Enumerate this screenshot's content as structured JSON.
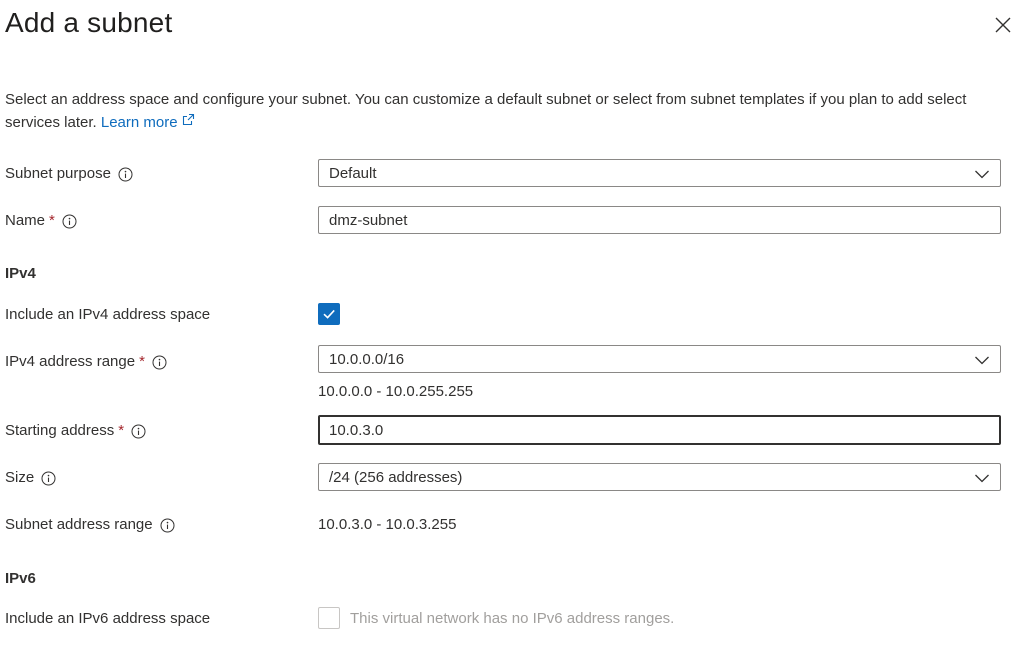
{
  "header": {
    "title": "Add a subnet",
    "close_icon": "close-icon"
  },
  "description": {
    "text": "Select an address space and configure your subnet. You can customize a default subnet or select from subnet templates if you plan to add select services later.",
    "link_label": "Learn more",
    "link_icon": "external-link-icon"
  },
  "form": {
    "subnet_purpose": {
      "label": "Subnet purpose",
      "value": "Default"
    },
    "name": {
      "label": "Name",
      "required_marker": "*",
      "value": "dmz-subnet"
    },
    "ipv4": {
      "section_title": "IPv4",
      "include_label": "Include an IPv4 address space",
      "include_checked": true,
      "address_range_label": "IPv4 address range",
      "address_range_required": "*",
      "address_range_value": "10.0.0.0/16",
      "address_range_hint": "10.0.0.0 - 10.0.255.255",
      "starting_address_label": "Starting address",
      "starting_address_required": "*",
      "starting_address_value": "10.0.3.0",
      "size_label": "Size",
      "size_value": "/24 (256 addresses)",
      "subnet_range_label": "Subnet address range",
      "subnet_range_value": "10.0.3.0 - 10.0.3.255"
    },
    "ipv6": {
      "section_title": "IPv6",
      "include_label": "Include an IPv6 address space",
      "include_checked": false,
      "disabled_message": "This virtual network has no IPv6 address ranges."
    }
  },
  "colors": {
    "accent": "#0f6cbd",
    "required": "#a4262c",
    "disabled": "#a19f9d",
    "border": "#8a8886"
  }
}
